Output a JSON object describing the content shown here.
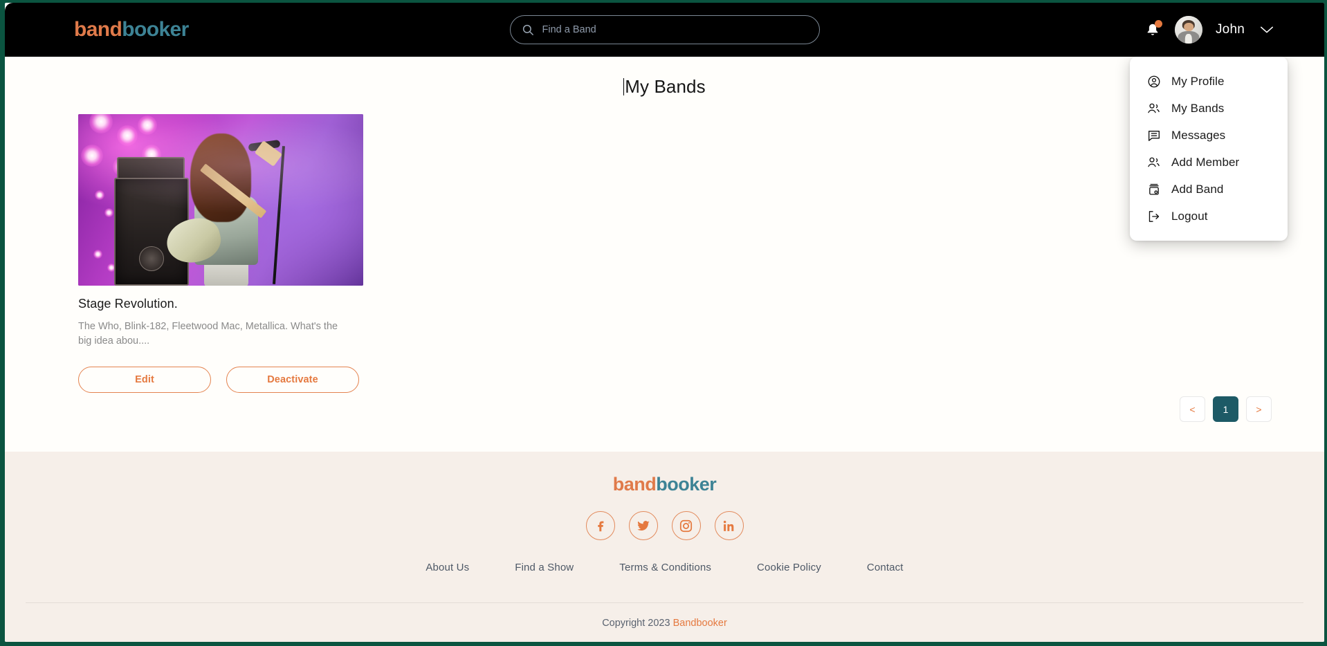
{
  "brand": {
    "name_part_a": "band",
    "name_part_b": "booker",
    "accent_orange": "#e5793f",
    "accent_teal": "#3d8395",
    "pagination_teal": "#1d5a66",
    "border_green": "#0b5440"
  },
  "header": {
    "search": {
      "placeholder": "Find a Band",
      "value": "",
      "icon": "search-icon"
    },
    "notifications": {
      "icon": "bell-icon",
      "has_unread": true
    },
    "user": {
      "name": "John",
      "avatar_icon": "user-avatar",
      "chevron_icon": "chevron-down-icon"
    }
  },
  "dropdown": {
    "items": [
      {
        "label": "My Profile",
        "icon": "user-circle-icon"
      },
      {
        "label": "My Bands",
        "icon": "users-icon"
      },
      {
        "label": "Messages",
        "icon": "message-square-icon"
      },
      {
        "label": "Add Member",
        "icon": "users-icon"
      },
      {
        "label": "Add Band",
        "icon": "archive-box-icon"
      },
      {
        "label": "Logout",
        "icon": "logout-icon"
      }
    ]
  },
  "main": {
    "title": "My Bands",
    "bands": [
      {
        "name": "Stage Revolution.",
        "description": "The Who, Blink-182, Fleetwood Mac, Metallica. What's the big idea abou....",
        "photo_alt": "bassist-on-stage-photo",
        "edit_label": "Edit",
        "deactivate_label": "Deactivate"
      }
    ],
    "pagination": {
      "prev_label": "<",
      "next_label": ">",
      "pages": [
        "1"
      ],
      "current": "1"
    }
  },
  "footer": {
    "logo_part_a": "band",
    "logo_part_b": "booker",
    "socials": [
      {
        "name": "facebook-icon"
      },
      {
        "name": "twitter-icon"
      },
      {
        "name": "instagram-icon"
      },
      {
        "name": "linkedin-icon"
      }
    ],
    "links": [
      {
        "label": "About Us"
      },
      {
        "label": "Find a Show"
      },
      {
        "label": "Terms & Conditions"
      },
      {
        "label": "Cookie Policy"
      },
      {
        "label": "Contact"
      }
    ],
    "copyright_prefix": "Copyright 2023 ",
    "copyright_brand": "Bandbooker"
  }
}
